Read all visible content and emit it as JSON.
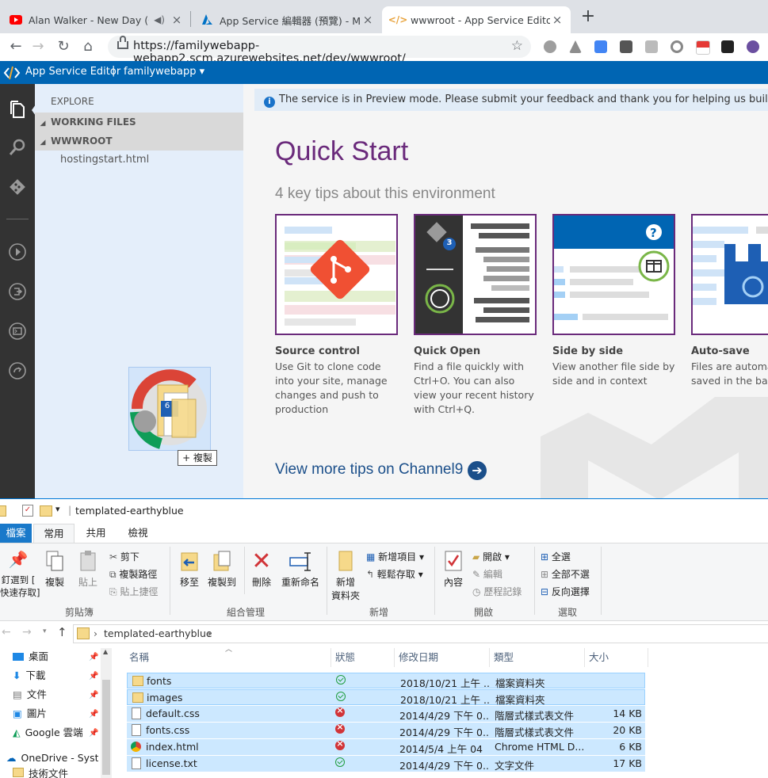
{
  "browser": {
    "tabs": [
      {
        "title": "Alan Walker - New Day (Offi",
        "icon": "youtube-icon"
      },
      {
        "title": "App Service 編輯器 (預覽) - Micr",
        "icon": "azure-icon"
      },
      {
        "title": "wwwroot - App Service Editor",
        "icon": "code-icon"
      }
    ],
    "url": "https://familywebapp-webapp2.scm.azurewebsites.net/dev/wwwroot/"
  },
  "ase": {
    "brand": "App Service Editor",
    "separator": "|",
    "site": "familywebapp ▾",
    "explorer": {
      "header": "EXPLORE",
      "working_files": "WORKING FILES",
      "root": "WWWROOT",
      "files": [
        "hostingstart.html"
      ]
    },
    "drag": {
      "badge": "6",
      "tooltip": "+ 複製"
    },
    "banner": "The service is in Preview mode. Please submit your feedback and thank you for helping us build a great service",
    "quickstart": {
      "title": "Quick Start",
      "subtitle": "4 key tips about this environment",
      "cards": [
        {
          "title": "Source control",
          "text": "Use Git to clone code into your site, manage changes and push to production"
        },
        {
          "title": "Quick Open",
          "text": "Find a file quickly with Ctrl+O. You can also view your recent history with Ctrl+Q.",
          "badge": "3"
        },
        {
          "title": "Side by side",
          "text": "View another file side by side and in context"
        },
        {
          "title": "Auto-save",
          "text": "Files are automatically saved in the background"
        }
      ],
      "more_tips": "View more tips on Channel9"
    }
  },
  "explorer_window": {
    "title": "templated-earthyblue",
    "tabs": [
      "檔案",
      "常用",
      "共用",
      "檢視"
    ],
    "ribbon": {
      "clipboard": {
        "pin": "釘選到 [",
        "pin2": "快速存取]",
        "copy": "複製",
        "paste": "貼上",
        "cut": "剪下",
        "copy_path": "複製路徑",
        "paste_shortcut": "貼上捷徑",
        "group": "剪貼簿"
      },
      "organize": {
        "move": "移至",
        "copy_to": "複製到",
        "delete": "刪除",
        "rename": "重新命名",
        "group": "組合管理"
      },
      "new": {
        "new_folder": "新增",
        "new_folder2": "資料夾",
        "new_item": "新增項目 ▾",
        "easy_access": "輕鬆存取 ▾",
        "group": "新增"
      },
      "open": {
        "properties": "內容",
        "open": "開啟 ▾",
        "edit": "編輯",
        "history": "歷程記錄",
        "group": "開啟"
      },
      "select": {
        "all": "全選",
        "none": "全部不選",
        "invert": "反向選擇",
        "group": "選取"
      }
    },
    "breadcrumb": "templated-earthyblue",
    "nav": [
      "桌面",
      "下載",
      "文件",
      "圖片",
      "Google 雲端",
      "OneDrive - Syste",
      "技術文件"
    ],
    "columns": [
      "名稱",
      "狀態",
      "修改日期",
      "類型",
      "大小"
    ],
    "files": [
      {
        "name": "fonts",
        "date": "2018/10/21 上午 ...",
        "type": "檔案資料夾",
        "size": "",
        "status": "ok",
        "icon": "folder-icon"
      },
      {
        "name": "images",
        "date": "2018/10/21 上午 ...",
        "type": "檔案資料夾",
        "size": "",
        "status": "ok",
        "icon": "folder-icon"
      },
      {
        "name": "default.css",
        "date": "2014/4/29 下午 0...",
        "type": "階層式樣式表文件",
        "size": "14 KB",
        "status": "err",
        "icon": "css-file-icon"
      },
      {
        "name": "fonts.css",
        "date": "2014/4/29 下午 0...",
        "type": "階層式樣式表文件",
        "size": "20 KB",
        "status": "err",
        "icon": "css-file-icon"
      },
      {
        "name": "index.html",
        "date": "2014/5/4 上午 04",
        "type": "Chrome HTML D...",
        "size": "6 KB",
        "status": "err",
        "icon": "chrome-icon"
      },
      {
        "name": "license.txt",
        "date": "2014/4/29 下午 0...",
        "type": "文字文件",
        "size": "17 KB",
        "status": "ok",
        "icon": "text-file-icon"
      }
    ]
  }
}
